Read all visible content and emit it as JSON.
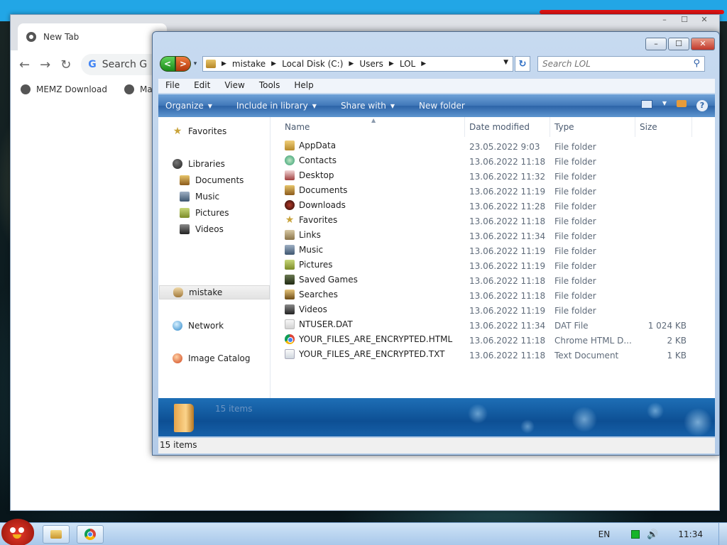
{
  "desktop": {
    "icons": {
      "edit": "pencil-icon"
    }
  },
  "chrome": {
    "tab_title": "New Tab",
    "omnibox_placeholder": "Search G",
    "bookmarks": [
      {
        "label": "MEMZ Download"
      },
      {
        "label": "Mal"
      }
    ],
    "window_buttons": [
      "–",
      "☐",
      "✕"
    ]
  },
  "explorer": {
    "caption_buttons": {
      "minimize": "–",
      "maximize": "☐",
      "close": "✕"
    },
    "nav": {
      "back": "<",
      "forward": ">"
    },
    "breadcrumb": [
      "mistake",
      "Local Disk (C:)",
      "Users",
      "LOL"
    ],
    "search_placeholder": "Search LOL",
    "menu": [
      "File",
      "Edit",
      "View",
      "Tools",
      "Help"
    ],
    "commands": [
      "Organize",
      "Include in library",
      "Share with",
      "New folder"
    ],
    "help": "?",
    "nav_pane": {
      "favorites": "Favorites",
      "libraries": "Libraries",
      "library_items": [
        "Documents",
        "Music",
        "Pictures",
        "Videos"
      ],
      "user": "mistake",
      "network": "Network",
      "catalog": "Image Catalog"
    },
    "columns": {
      "name": "Name",
      "date": "Date modified",
      "type": "Type",
      "size": "Size"
    },
    "files": [
      {
        "name": "AppData",
        "date": "23.05.2022 9:03",
        "type": "File folder",
        "size": "",
        "icon": "ico-folder"
      },
      {
        "name": "Contacts",
        "date": "13.06.2022 11:18",
        "type": "File folder",
        "size": "",
        "icon": "ico-contacts"
      },
      {
        "name": "Desktop",
        "date": "13.06.2022 11:32",
        "type": "File folder",
        "size": "",
        "icon": "ico-desktop"
      },
      {
        "name": "Documents",
        "date": "13.06.2022 11:19",
        "type": "File folder",
        "size": "",
        "icon": "ico-doc"
      },
      {
        "name": "Downloads",
        "date": "13.06.2022 11:28",
        "type": "File folder",
        "size": "",
        "icon": "ico-downloads"
      },
      {
        "name": "Favorites",
        "date": "13.06.2022 11:18",
        "type": "File folder",
        "size": "",
        "icon": "ico-star"
      },
      {
        "name": "Links",
        "date": "13.06.2022 11:34",
        "type": "File folder",
        "size": "",
        "icon": "ico-links"
      },
      {
        "name": "Music",
        "date": "13.06.2022 11:19",
        "type": "File folder",
        "size": "",
        "icon": "ico-music"
      },
      {
        "name": "Pictures",
        "date": "13.06.2022 11:19",
        "type": "File folder",
        "size": "",
        "icon": "ico-pic"
      },
      {
        "name": "Saved Games",
        "date": "13.06.2022 11:18",
        "type": "File folder",
        "size": "",
        "icon": "ico-games"
      },
      {
        "name": "Searches",
        "date": "13.06.2022 11:18",
        "type": "File folder",
        "size": "",
        "icon": "ico-search"
      },
      {
        "name": "Videos",
        "date": "13.06.2022 11:19",
        "type": "File folder",
        "size": "",
        "icon": "ico-video"
      },
      {
        "name": "NTUSER.DAT",
        "date": "13.06.2022 11:34",
        "type": "DAT File",
        "size": "1 024 KB",
        "icon": "ico-file"
      },
      {
        "name": "YOUR_FILES_ARE_ENCRYPTED.HTML",
        "date": "13.06.2022 11:18",
        "type": "Chrome HTML D...",
        "size": "2 KB",
        "icon": "ico-chrome"
      },
      {
        "name": "YOUR_FILES_ARE_ENCRYPTED.TXT",
        "date": "13.06.2022 11:18",
        "type": "Text Document",
        "size": "1 KB",
        "icon": "ico-txt"
      }
    ],
    "details_count": "15 items",
    "status_count": "15 items"
  },
  "taskbar": {
    "language": "EN",
    "clock": "11:34",
    "volume_icon": "🔊"
  }
}
